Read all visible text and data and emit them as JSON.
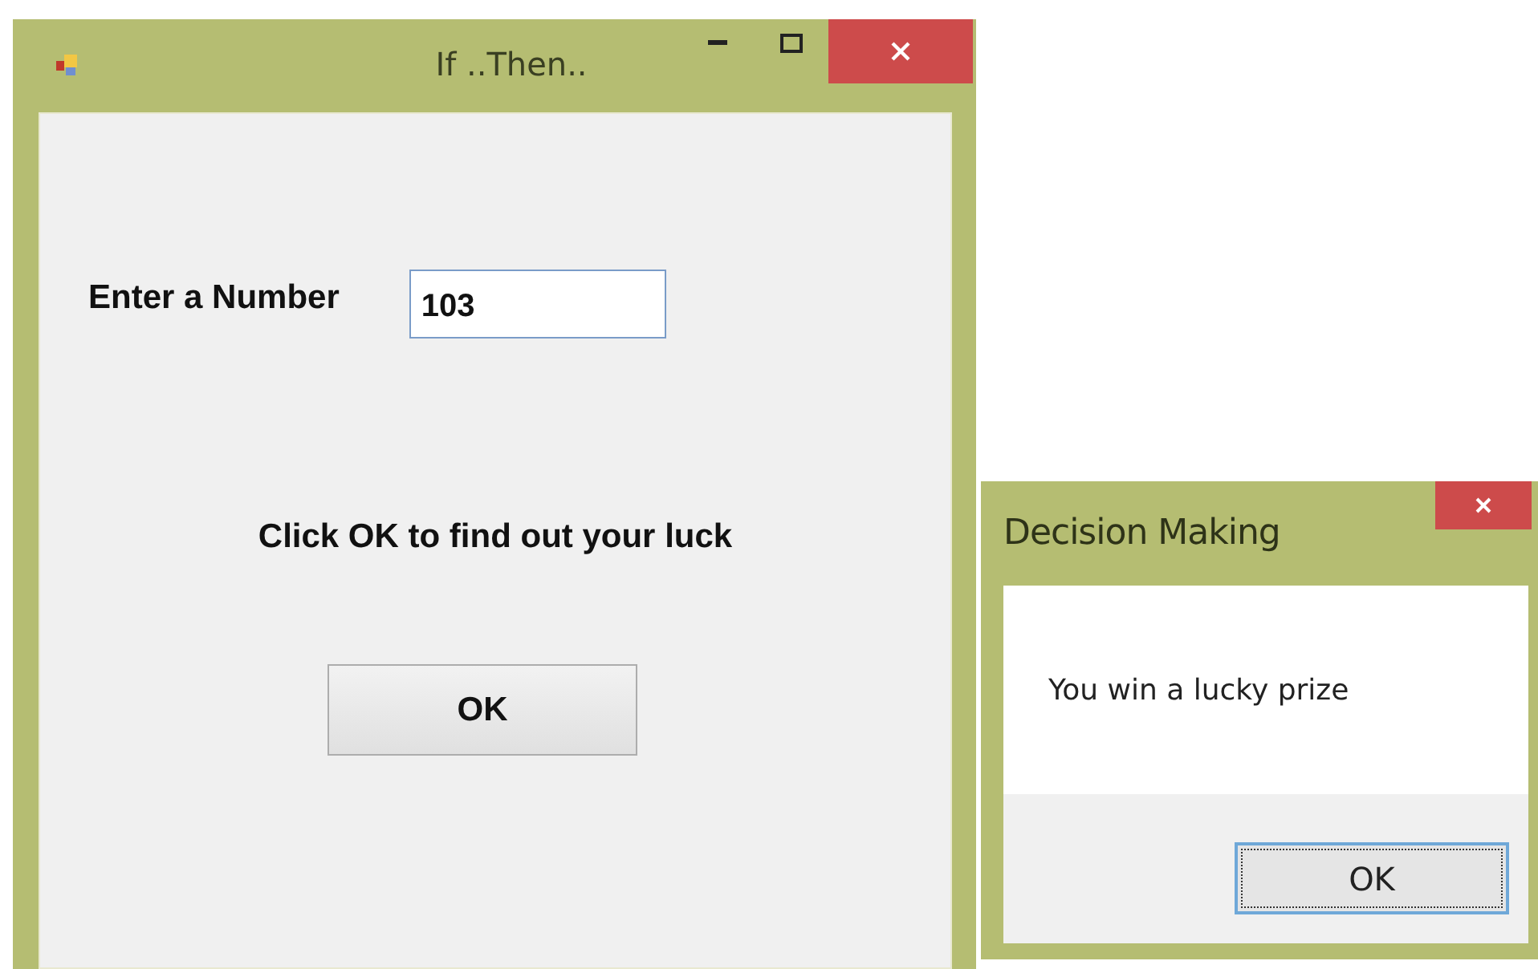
{
  "main_window": {
    "title": "If ..Then..",
    "label": "Enter a Number",
    "number_field": {
      "value": "103"
    },
    "message": "Click OK to find out your luck",
    "button": {
      "label": "OK"
    }
  },
  "dialog": {
    "title": "Decision Making",
    "message": "You win a lucky prize",
    "button": {
      "label": "OK",
      "focused": true
    }
  }
}
